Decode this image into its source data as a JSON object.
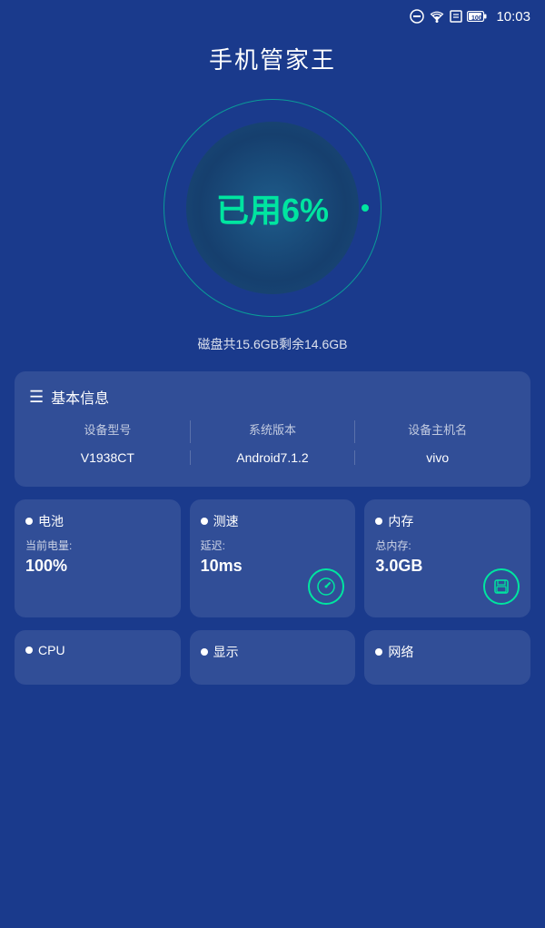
{
  "statusBar": {
    "time": "10:03"
  },
  "header": {
    "title": "手机管家王"
  },
  "gauge": {
    "percent": "已用6%",
    "diskInfo": "磁盘共15.6GB剩余14.6GB"
  },
  "basicInfo": {
    "sectionTitle": "基本信息",
    "columns": [
      "设备型号",
      "系统版本",
      "设备主机名"
    ],
    "values": [
      "V1938CT",
      "Android7.1.2",
      "vivo"
    ]
  },
  "stats": [
    {
      "dot": true,
      "title": "电池",
      "label": "当前电量:",
      "value": "100%",
      "iconType": "none"
    },
    {
      "dot": true,
      "title": "测速",
      "label": "延迟:",
      "value": "10ms",
      "iconType": "speedometer"
    },
    {
      "dot": true,
      "title": "内存",
      "label": "总内存:",
      "value": "3.0GB",
      "iconType": "save"
    }
  ],
  "bottomCards": [
    {
      "title": "CPU"
    },
    {
      "title": "显示"
    },
    {
      "title": "网络"
    }
  ],
  "colors": {
    "accent": "#00e5a0",
    "bg": "#1a3a8c",
    "cardBg": "rgba(255,255,255,0.1)"
  }
}
